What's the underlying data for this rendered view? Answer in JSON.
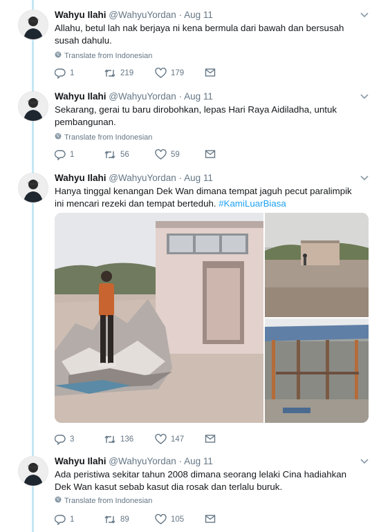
{
  "tweets": [
    {
      "name": "Wahyu Ilahi",
      "handle": "@WahyuYordan",
      "time": "Aug 11",
      "text": "Allahu, betul lah nak berjaya ni kena bermula dari bawah dan bersusah susah dahulu.",
      "translate": "Translate from Indonesian",
      "replies": "1",
      "retweets": "219",
      "likes": "179"
    },
    {
      "name": "Wahyu Ilahi",
      "handle": "@WahyuYordan",
      "time": "Aug 11",
      "text": "Sekarang, gerai tu baru dirobohkan, lepas Hari Raya Aidiladha, untuk pembangunan.",
      "translate": "Translate from Indonesian",
      "replies": "1",
      "retweets": "56",
      "likes": "59"
    },
    {
      "name": "Wahyu Ilahi",
      "handle": "@WahyuYordan",
      "time": "Aug 11",
      "text": "Hanya tinggal kenangan Dek Wan dimana tempat jaguh pecut paralimpik ini mencari rezeki dan tempat berteduh.",
      "hashtag": "#KamiLuarBiasa",
      "replies": "3",
      "retweets": "136",
      "likes": "147"
    },
    {
      "name": "Wahyu Ilahi",
      "handle": "@WahyuYordan",
      "time": "Aug 11",
      "text": "Ada peristiwa sekitar tahun 2008 dimana seorang lelaki Cina hadiahkan Dek Wan kasut sebab kasut dia rosak dan terlalu buruk.",
      "translate": "Translate from Indonesian",
      "replies": "1",
      "retweets": "89",
      "likes": "105"
    }
  ],
  "icons": {
    "reply": "reply-icon",
    "retweet": "retweet-icon",
    "like": "heart-icon",
    "dm": "envelope-icon",
    "globe": "globe-icon",
    "caret": "chevron-down-icon"
  },
  "colors": {
    "thread_line": "#c4e7f4",
    "link": "#1da1f2",
    "secondary_text": "#657786"
  }
}
